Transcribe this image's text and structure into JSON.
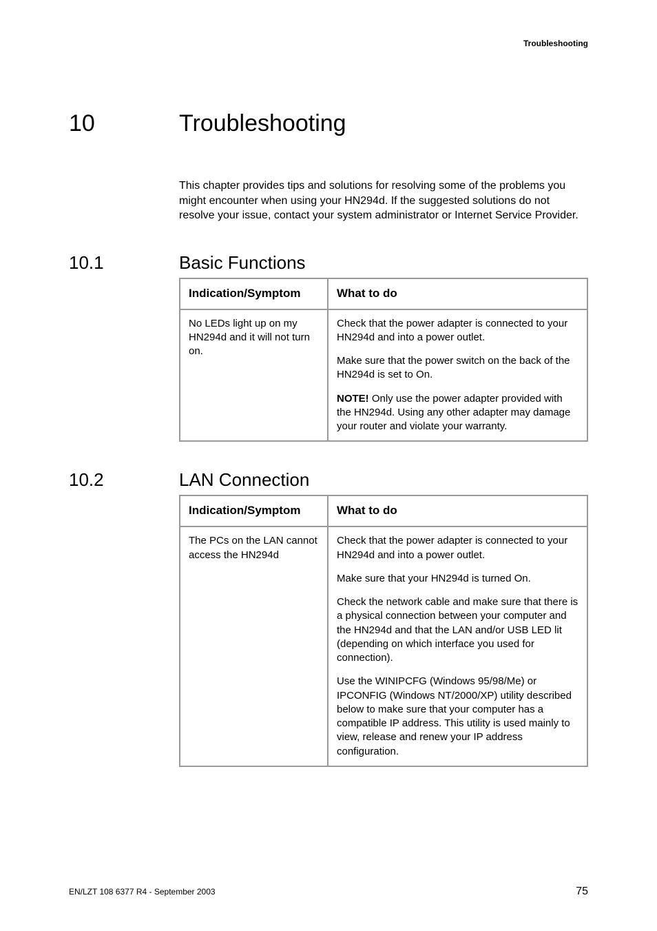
{
  "running_header": "Troubleshooting",
  "chapter": {
    "number": "10",
    "title": "Troubleshooting"
  },
  "intro": "This chapter provides tips and solutions for resolving some of the problems you might encounter when using your HN294d. If the suggested solutions do not resolve your issue, contact your system administrator or Internet Service Provider.",
  "section1": {
    "number": "10.1",
    "title": "Basic Functions",
    "table": {
      "head": {
        "col1": "Indication/Symptom",
        "col2": "What to do"
      },
      "rows": [
        {
          "col1": "No LEDs light up on my HN294d and it will not turn on.",
          "col2_p1": "Check that the power adapter is connected to your HN294d and into a power outlet.",
          "col2_p2": "Make sure that the power switch on the back of the HN294d is set to On.",
          "col2_p3_bold": "NOTE!",
          "col2_p3_rest": " Only use the power adapter provided with the HN294d. Using any other adapter may damage your router and violate your warranty."
        }
      ]
    }
  },
  "section2": {
    "number": "10.2",
    "title": "LAN Connection",
    "table": {
      "head": {
        "col1": "Indication/Symptom",
        "col2": "What to do"
      },
      "rows": [
        {
          "col1": "The PCs on the LAN cannot access the HN294d",
          "col2_p1": "Check that the power adapter is connected to your HN294d and into a power outlet.",
          "col2_p2": "Make sure that your HN294d is turned On.",
          "col2_p3": "Check the network cable and make sure that there is a physical connection between your computer and the HN294d and that the LAN and/or USB LED lit (depending on which interface you used for connection).",
          "col2_p4": "Use the WINIPCFG (Windows 95/98/Me) or IPCONFIG (Windows NT/2000/XP) utility described below to make sure that your computer has a compatible IP address. This utility is used mainly to view, release and renew your IP address configuration."
        }
      ]
    }
  },
  "footer": {
    "left": "EN/LZT 108 6377 R4 - September 2003",
    "right": "75"
  }
}
